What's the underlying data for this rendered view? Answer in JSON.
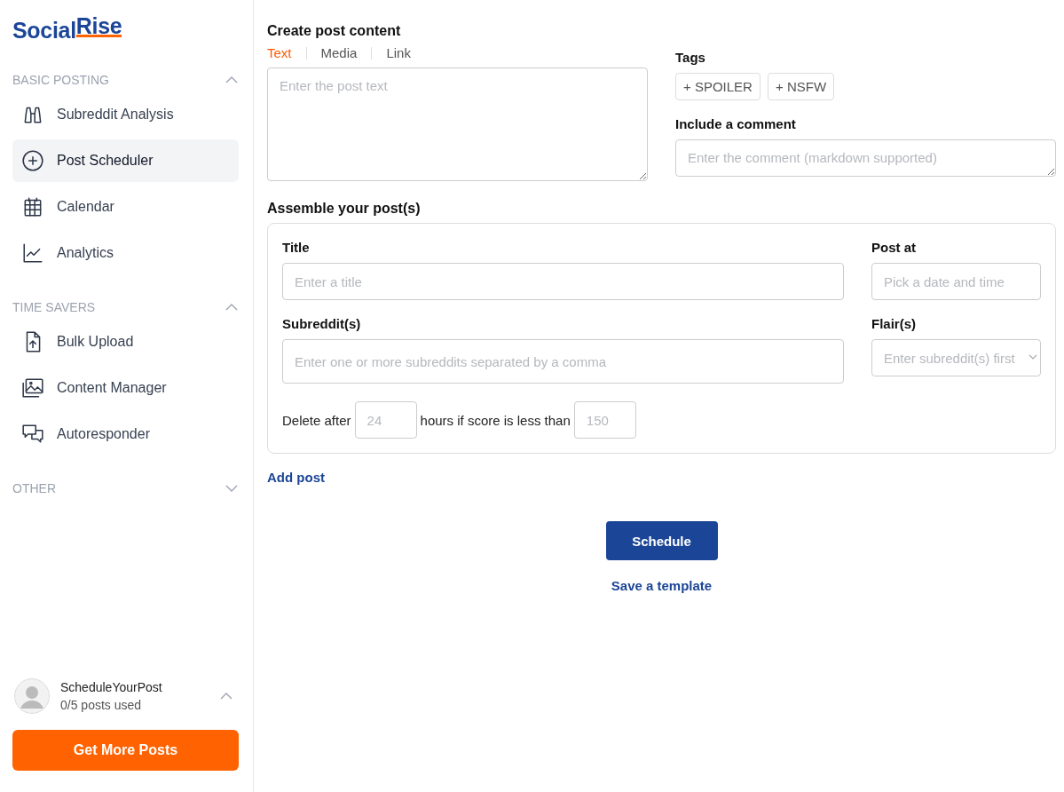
{
  "brand": {
    "name": "Social",
    "accent": "Rise"
  },
  "sidebar": {
    "sections": [
      {
        "title": "BASIC POSTING",
        "expanded": true,
        "items": [
          {
            "label": "Subreddit Analysis",
            "selected": false
          },
          {
            "label": "Post Scheduler",
            "selected": true
          },
          {
            "label": "Calendar",
            "selected": false
          },
          {
            "label": "Analytics",
            "selected": false
          }
        ]
      },
      {
        "title": "TIME SAVERS",
        "expanded": true,
        "items": [
          {
            "label": "Bulk Upload",
            "selected": false
          },
          {
            "label": "Content Manager",
            "selected": false
          },
          {
            "label": "Autoresponder",
            "selected": false
          }
        ]
      },
      {
        "title": "OTHER",
        "expanded": false
      }
    ]
  },
  "account": {
    "name": "ScheduleYourPost",
    "usage": "0/5 posts used",
    "expanded": true
  },
  "upgrade_button": "Get More Posts",
  "content": {
    "title": "Create post content",
    "tabs": [
      {
        "label": "Text",
        "selected": true
      },
      {
        "label": "Media",
        "selected": false
      },
      {
        "label": "Link",
        "selected": false
      }
    ],
    "text_placeholder": "Enter the post text",
    "tags_label": "Tags",
    "tags": [
      "+ SPOILER",
      "+ NSFW"
    ],
    "comment_label": "Include a comment",
    "comment_placeholder": "Enter the comment (markdown supported)"
  },
  "assemble": {
    "title": "Assemble your post(s)",
    "title_label": "Title",
    "title_placeholder": "Enter a title",
    "post_at_label": "Post at",
    "post_at_placeholder": "Pick a date and time",
    "subreddits_label": "Subreddit(s)",
    "subreddits_placeholder": "Enter one or more subreddits separated by a comma",
    "flair_label": "Flair(s)",
    "flair_placeholder": "Enter subreddit(s) first",
    "delete_prefix": "Delete after",
    "hours_placeholder": "24",
    "delete_middle": "hours if score is less than",
    "score_placeholder": "150"
  },
  "add_post": "Add post",
  "schedule_button": "Schedule",
  "template_link": "Save a template"
}
